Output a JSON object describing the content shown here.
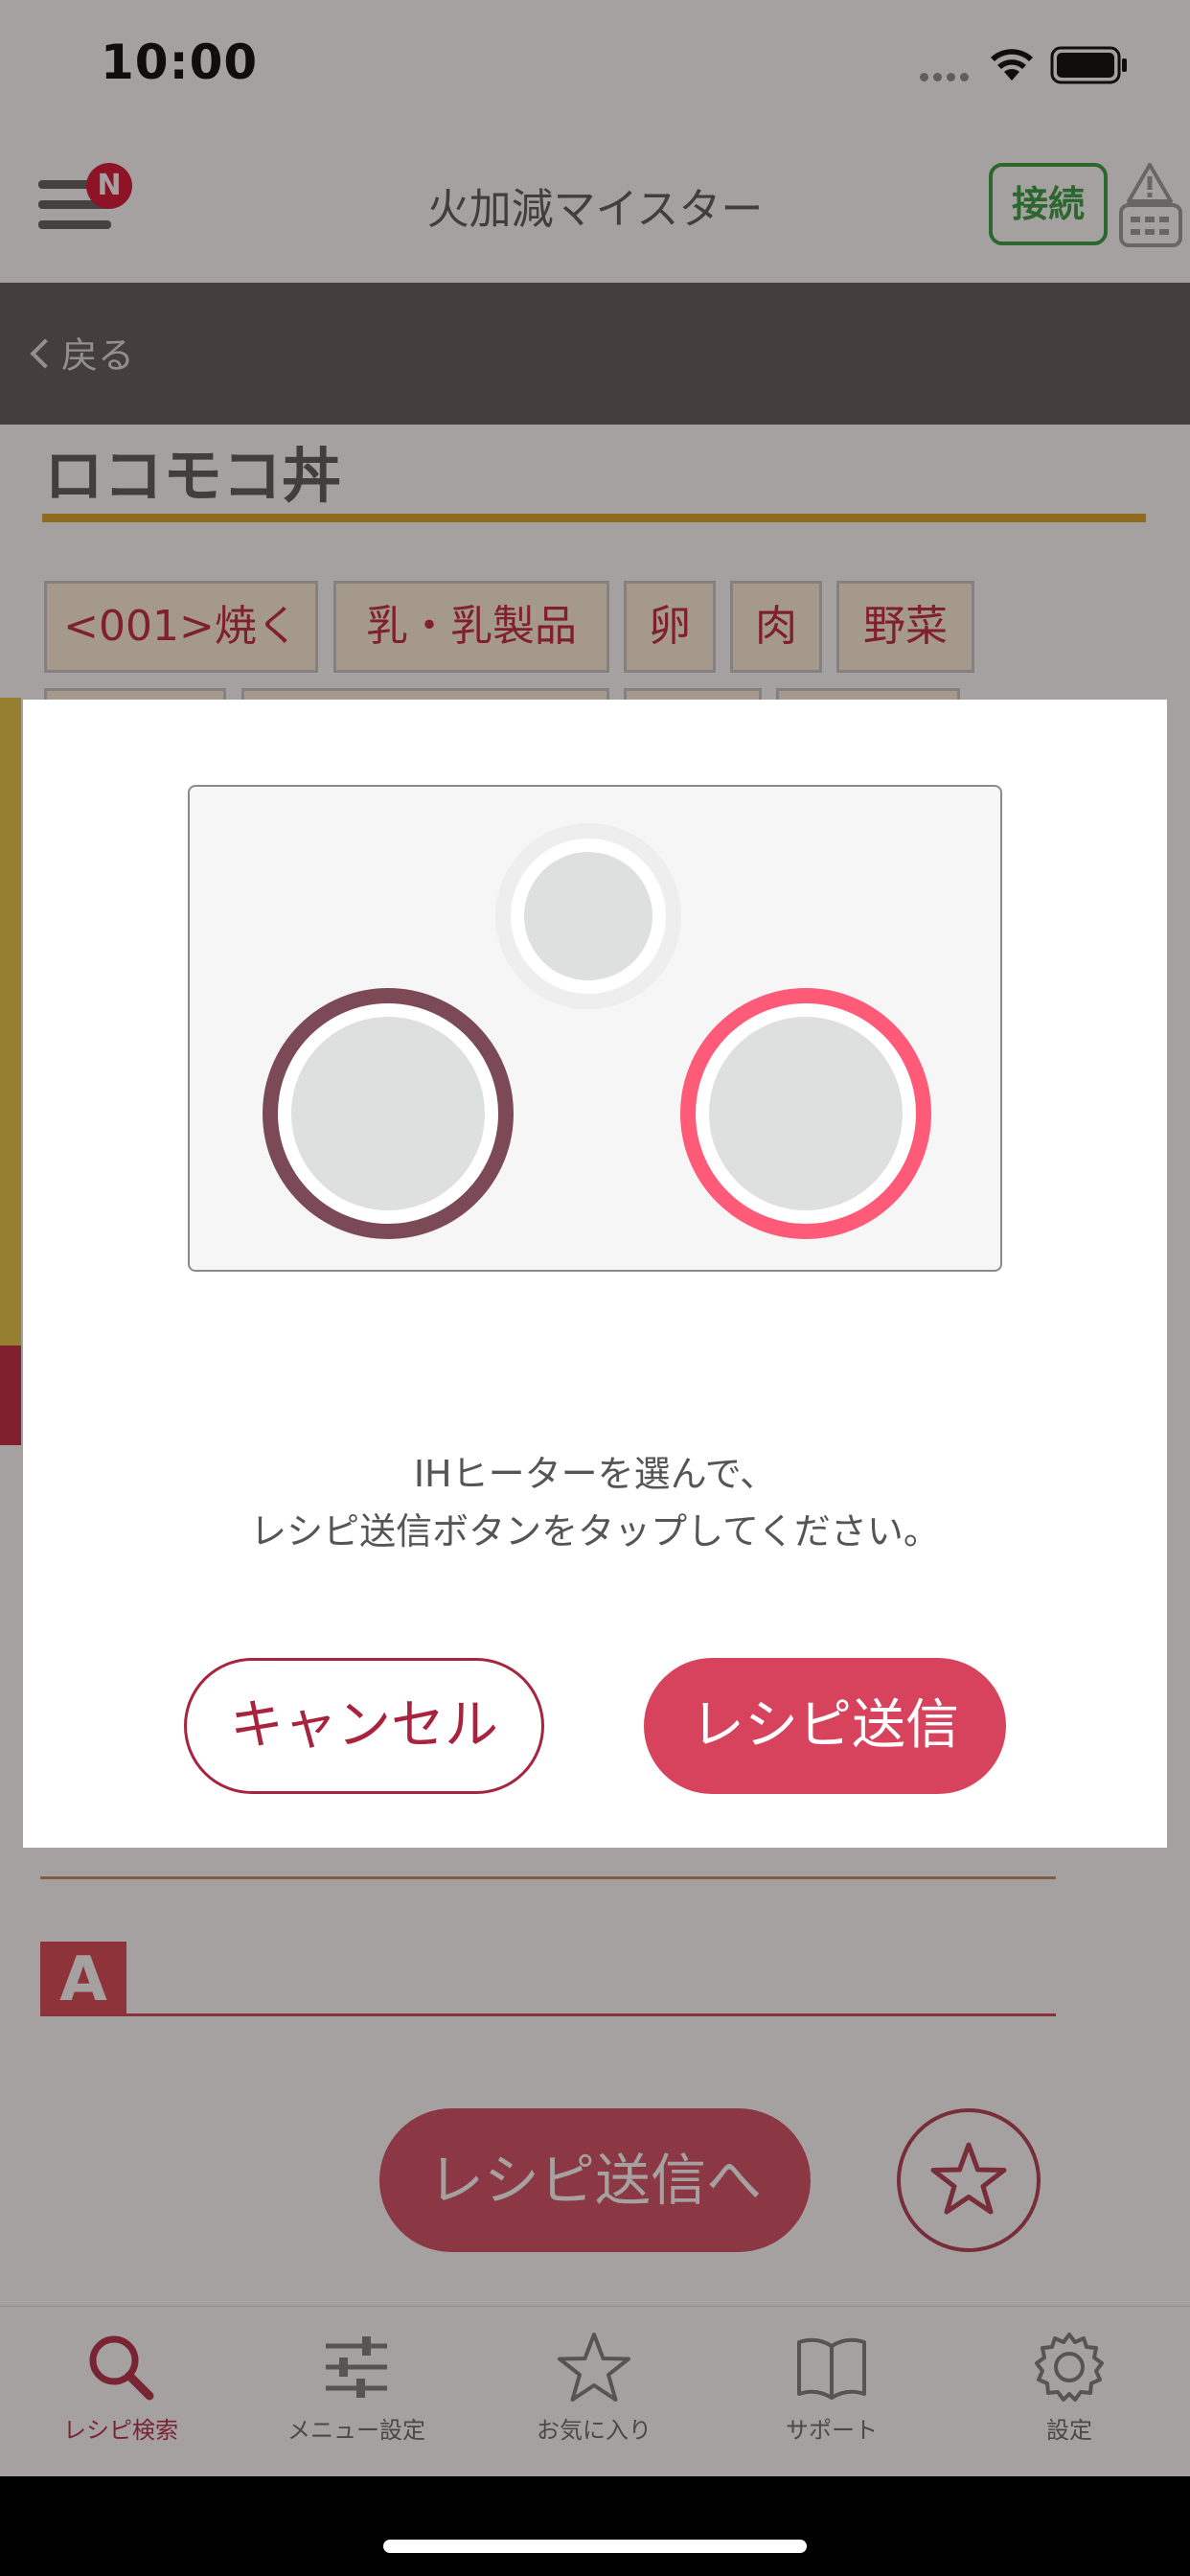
{
  "status_bar": {
    "time": "10:00"
  },
  "nav": {
    "title": "火加減マイスター",
    "badge": "N",
    "connect_label": "接続"
  },
  "back_bar": {
    "back_label": "戻る"
  },
  "recipe": {
    "title": "ロコモコ丼",
    "tags": [
      "<001>焼く",
      "乳・乳製品",
      "卵",
      "肉",
      "野菜"
    ],
    "section_letter": "A"
  },
  "actions": {
    "send_recipe_label": "レシピ送信へ"
  },
  "tabs": [
    {
      "label": "レシピ検索",
      "icon": "search-icon",
      "active": true
    },
    {
      "label": "メニュー設定",
      "icon": "sliders-icon",
      "active": false
    },
    {
      "label": "お気に入り",
      "icon": "star-icon",
      "active": false
    },
    {
      "label": "サポート",
      "icon": "book-icon",
      "active": false
    },
    {
      "label": "設定",
      "icon": "gear-icon",
      "active": false
    }
  ],
  "modal": {
    "message_line1": "IHヒーターを選んで、",
    "message_line2": "レシピ送信ボタンをタップしてください。",
    "cancel_label": "キャンセル",
    "send_label": "レシピ送信",
    "burners": [
      {
        "position": "back-center",
        "state": "disabled",
        "ring_color": "#eeeeee"
      },
      {
        "position": "front-left",
        "state": "available",
        "ring_color": "#7c4a57"
      },
      {
        "position": "front-right",
        "state": "selected",
        "ring_color": "#ff5a78"
      }
    ]
  },
  "colors": {
    "accent": "#c0213a",
    "connect": "#2e9b3a",
    "title_underline": "#d9a21e"
  }
}
